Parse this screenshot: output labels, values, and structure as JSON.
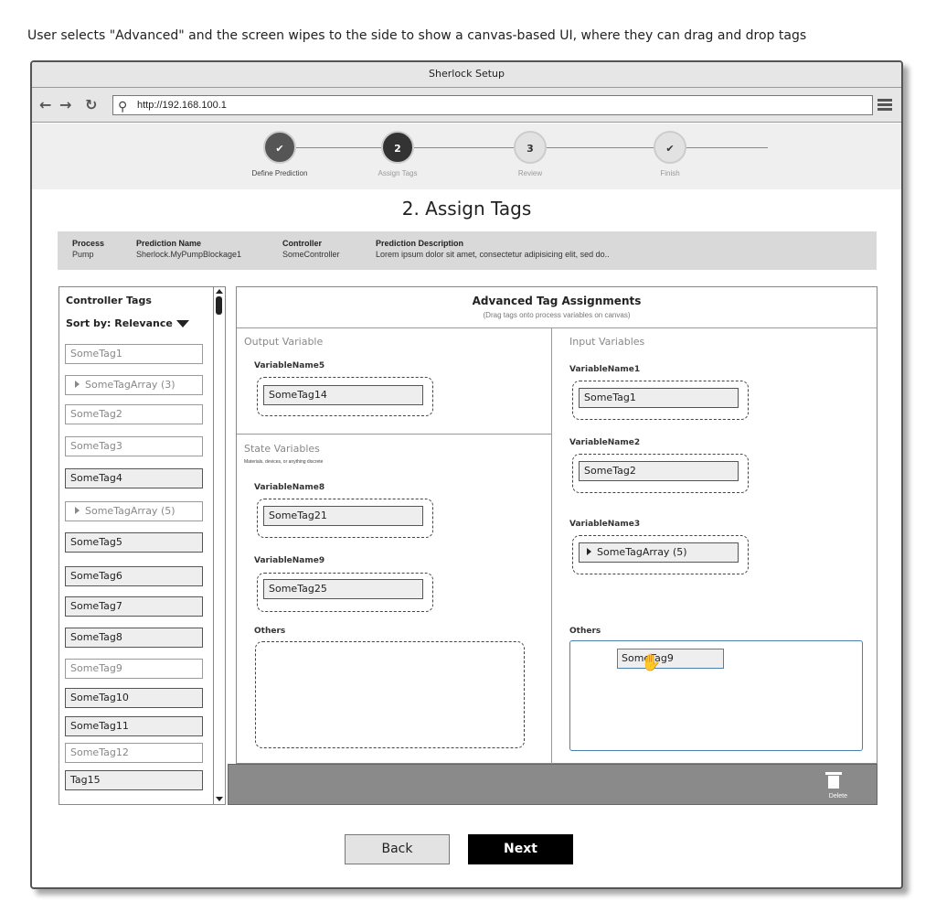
{
  "caption": "User selects \"Advanced\" and the screen wipes to the side to show a canvas-based UI, where they can drag and drop tags",
  "window": {
    "title": "Sherlock Setup"
  },
  "browser": {
    "url": "http://192.168.100.1"
  },
  "stepper": {
    "steps": [
      {
        "label": "Define Prediction",
        "marker": "✔",
        "state": "done"
      },
      {
        "label": "Assign Tags",
        "marker": "2",
        "state": "active"
      },
      {
        "label": "Review",
        "marker": "3",
        "state": "todo"
      },
      {
        "label": "Finish",
        "marker": "✔",
        "state": "todo"
      }
    ]
  },
  "page_title": "2. Assign Tags",
  "info": {
    "process": {
      "label": "Process",
      "value": "Pump"
    },
    "prediction_name": {
      "label": "Prediction Name",
      "value": "Sherlock.MyPumpBlockage1"
    },
    "controller": {
      "label": "Controller",
      "value": "SomeController"
    },
    "description": {
      "label": "Prediction Description",
      "value": "Lorem ipsum dolor sit amet, consectetur adipisicing elit, sed do.."
    }
  },
  "controller_tags": {
    "title": "Controller Tags",
    "sort_label": "Sort by: Relevance",
    "items": [
      {
        "label": "SomeTag1",
        "dim": true
      },
      {
        "label": "SomeTagArray (3)",
        "dim": true,
        "expandable": true
      },
      {
        "label": "SomeTag2",
        "dim": true
      },
      {
        "label": "SomeTag3",
        "dim": true
      },
      {
        "label": "SomeTag4",
        "dim": false
      },
      {
        "label": "SomeTagArray (5)",
        "dim": true,
        "expandable": true
      },
      {
        "label": "SomeTag5",
        "dim": false
      },
      {
        "label": "SomeTag6",
        "dim": false
      },
      {
        "label": "SomeTag7",
        "dim": false
      },
      {
        "label": "SomeTag8",
        "dim": false
      },
      {
        "label": "SomeTag9",
        "dim": true
      },
      {
        "label": "SomeTag10",
        "dim": false
      },
      {
        "label": "SomeTag11",
        "dim": false
      },
      {
        "label": "SomeTag12",
        "dim": true
      },
      {
        "label": "Tag15",
        "dim": false
      }
    ]
  },
  "canvas": {
    "title": "Advanced Tag Assignments",
    "subtitle": "(Drag tags onto process variables on canvas)",
    "output": {
      "title": "Output Variable",
      "var_name": "VariableName5",
      "tag": "SomeTag14"
    },
    "state": {
      "title": "State Variables",
      "subtitle": "Materials, devices, or anything discrete",
      "vars": [
        {
          "name": "VariableName8",
          "tag": "SomeTag21"
        },
        {
          "name": "VariableName9",
          "tag": "SomeTag25"
        }
      ],
      "others_label": "Others"
    },
    "input": {
      "title": "Input Variables",
      "vars": [
        {
          "name": "VariableName1",
          "tag": "SomeTag1"
        },
        {
          "name": "VariableName2",
          "tag": "SomeTag2"
        },
        {
          "name": "VariableName3",
          "tag": "SomeTagArray (5)"
        }
      ],
      "others_label": "Others",
      "dragging_tag": "SomeTag9"
    }
  },
  "trash": {
    "label": "Delete"
  },
  "buttons": {
    "back": "Back",
    "next": "Next"
  }
}
